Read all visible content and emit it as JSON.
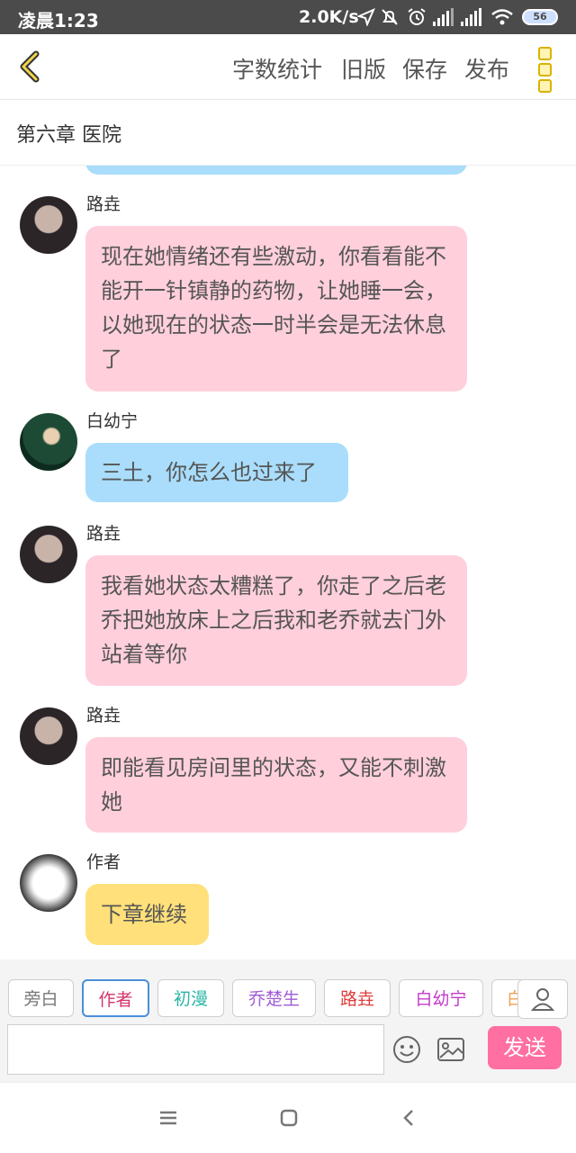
{
  "status": {
    "time": "凌晨1:23",
    "net_speed": "2.0K/s",
    "battery": "56"
  },
  "toolbar": {
    "word_count": "字数统计",
    "old_version": "旧版",
    "save": "保存",
    "publish": "发布"
  },
  "chapter_title": "第六章  医院",
  "messages": [
    {
      "name": "路垚",
      "text": "现在她情绪还有些激动，你看看能不能开一针镇静的药物，让她睡一会，以她现在的状态一时半会是无法休息了",
      "color": "pink"
    },
    {
      "name": "白幼宁",
      "text": "三土，你怎么也过来了",
      "color": "blue"
    },
    {
      "name": "路垚",
      "text": "我看她状态太糟糕了，你走了之后老乔把她放床上之后我和老乔就去门外站着等你",
      "color": "pink"
    },
    {
      "name": "路垚",
      "text": "即能看见房间里的状态，又能不刺激她",
      "color": "pink"
    },
    {
      "name": "作者",
      "text": "下章继续",
      "color": "yellow"
    }
  ],
  "roles": [
    {
      "label": "旁白",
      "color": "#777777"
    },
    {
      "label": "作者",
      "color": "#d6336c"
    },
    {
      "label": "初漫",
      "color": "#2bb5a7"
    },
    {
      "label": "乔楚生",
      "color": "#a05bd6"
    },
    {
      "label": "路垚",
      "color": "#e03a3a"
    },
    {
      "label": "白幼宁",
      "color": "#c23bc9"
    },
    {
      "label": "白",
      "color": "#f0a050"
    }
  ],
  "send_label": "发送",
  "icons": {
    "back": "chevron-left-icon",
    "menu": "more-menu-icon",
    "emoji": "smiley-icon",
    "image": "image-icon",
    "profile": "person-icon"
  }
}
